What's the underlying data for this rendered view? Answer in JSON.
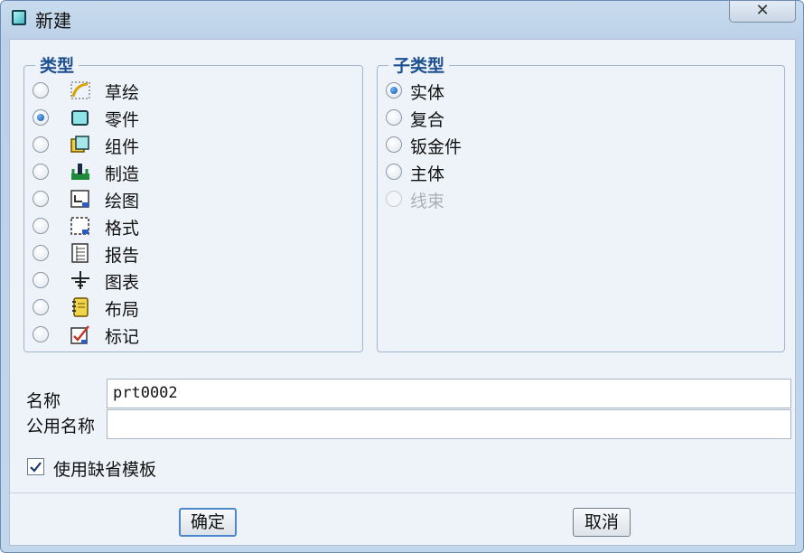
{
  "window": {
    "title": "新建",
    "close_glyph": "✕"
  },
  "type_group": {
    "legend": "类型",
    "items": [
      {
        "label": "草绘",
        "icon": "sketch-icon",
        "selected": false
      },
      {
        "label": "零件",
        "icon": "part-icon",
        "selected": true
      },
      {
        "label": "组件",
        "icon": "assembly-icon",
        "selected": false
      },
      {
        "label": "制造",
        "icon": "manufacturing-icon",
        "selected": false
      },
      {
        "label": "绘图",
        "icon": "drawing-icon",
        "selected": false
      },
      {
        "label": "格式",
        "icon": "format-icon",
        "selected": false
      },
      {
        "label": "报告",
        "icon": "report-icon",
        "selected": false
      },
      {
        "label": "图表",
        "icon": "diagram-icon",
        "selected": false
      },
      {
        "label": "布局",
        "icon": "layout-icon",
        "selected": false
      },
      {
        "label": "标记",
        "icon": "markup-icon",
        "selected": false
      }
    ]
  },
  "subtype_group": {
    "legend": "子类型",
    "items": [
      {
        "label": "实体",
        "selected": true,
        "enabled": true
      },
      {
        "label": "复合",
        "selected": false,
        "enabled": true
      },
      {
        "label": "钣金件",
        "selected": false,
        "enabled": true
      },
      {
        "label": "主体",
        "selected": false,
        "enabled": true
      },
      {
        "label": "线束",
        "selected": false,
        "enabled": false
      }
    ]
  },
  "form": {
    "name_label": "名称",
    "name_value": "prt0002",
    "common_name_label": "公用名称",
    "common_name_value": "",
    "use_default_template_label": "使用缺省模板",
    "use_default_template_checked": true
  },
  "buttons": {
    "ok": "确定",
    "cancel": "取消"
  },
  "colors": {
    "legend": "#1e4f8f",
    "titlebar": "#bcd1e8",
    "dialog_body": "#eef3f9"
  }
}
